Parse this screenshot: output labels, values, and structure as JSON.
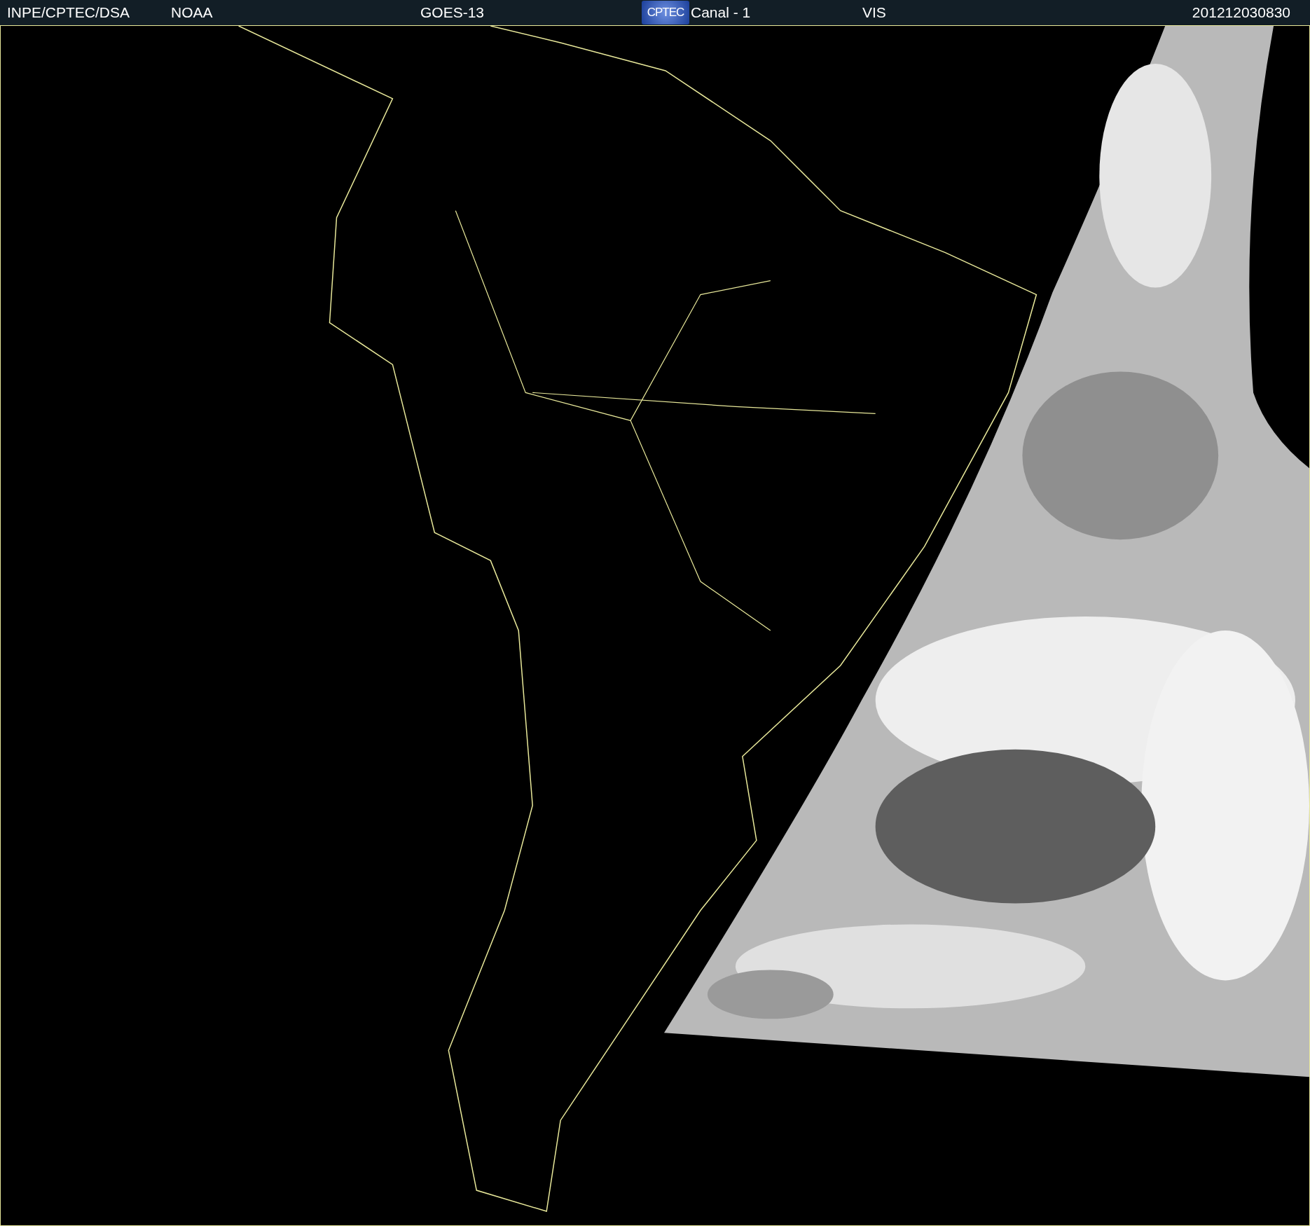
{
  "header": {
    "agency": "INPE/CPTEC/DSA",
    "source": "NOAA",
    "satellite": "GOES-13",
    "logo": "CPTEC",
    "channel": "Canal - 1",
    "band": "VIS",
    "timestamp": "201212030830"
  }
}
